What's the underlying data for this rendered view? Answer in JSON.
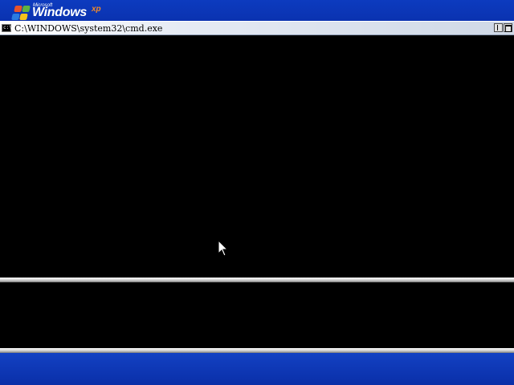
{
  "desktop": {
    "logo": {
      "brand_prefix": "Microsoft",
      "brand_name": "Windows",
      "brand_suffix": "xp"
    },
    "colors": {
      "desktop_blue": "#0a2fa8",
      "console_background": "#000000"
    }
  },
  "window": {
    "title": "C:\\WINDOWS\\system32\\cmd.exe",
    "icon": "cmd-icon",
    "icon_glyph": "c:\\",
    "buttons": [
      "restore",
      "maximize"
    ]
  },
  "console": {
    "text": ""
  },
  "cursor": {
    "type": "arrow-pointer"
  }
}
